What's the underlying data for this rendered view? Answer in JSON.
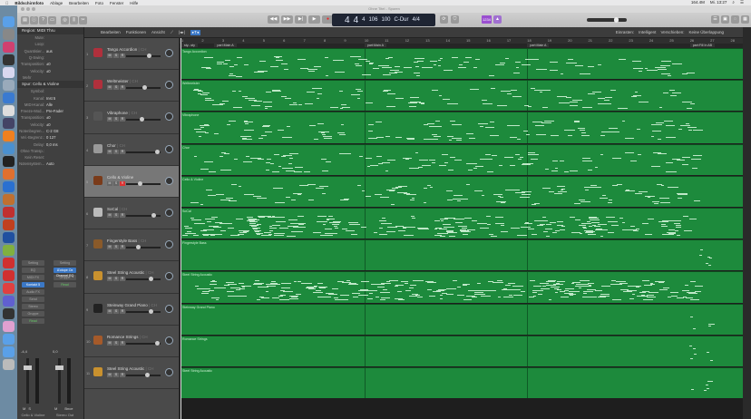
{
  "menubar": {
    "app": "Bildschirmfoto",
    "items": [
      "Ablage",
      "Bearbeiten",
      "Foto",
      "Fenster",
      "Hilfe"
    ],
    "memory": "164.4M",
    "clock": "Mi. 13:27"
  },
  "window": {
    "title": "Ohne Titel - Spuren"
  },
  "lcd": {
    "bar": "4",
    "beat": "4",
    "div": "4",
    "tempo": "106",
    "tick": "100",
    "key": "C-Dur",
    "signature": "4/4"
  },
  "count_in": "1234",
  "toolbar": {
    "edit": "Bearbeiten",
    "functions": "Funktionen",
    "view": "Ansicht",
    "snap_label": "Einrasten:",
    "snap_value": "Intelligent",
    "drag_label": "Verschieben:",
    "drag_value": "Keine Überlappung"
  },
  "inspector": {
    "region_header": "Region: MIDI Thru",
    "region_rows": [
      {
        "k": "Mute:",
        "v": ""
      },
      {
        "k": "Loop:",
        "v": ""
      },
      {
        "k": "Quantisier...",
        "v": "aus"
      },
      {
        "k": "Q-Swing:",
        "v": ""
      },
      {
        "k": "Transposition:",
        "v": "±0"
      },
      {
        "k": "Velocity:",
        "v": "±0"
      }
    ],
    "more": "Mehr",
    "track_header": "Spur: Cello & Violine",
    "track_rows": [
      {
        "k": "Symbol:",
        "v": ""
      },
      {
        "k": "Kanal:",
        "v": "Inst 5"
      },
      {
        "k": "MIDI-Kanal:",
        "v": "Alle"
      },
      {
        "k": "Freeze-Mod...",
        "v": "Pre-Fader"
      },
      {
        "k": "Transposition:",
        "v": "±0"
      },
      {
        "k": "Velocity:",
        "v": "±0"
      },
      {
        "k": "Notenbegren...",
        "v": "C-2  G8"
      },
      {
        "k": "Vel.-Begrenz.:",
        "v": "0  127"
      },
      {
        "k": "Delay:",
        "v": "0,0 ms"
      },
      {
        "k": "Ohne Transp.:",
        "v": ""
      },
      {
        "k": "Kein Reset:",
        "v": ""
      },
      {
        "k": "Notensystem...",
        "v": "Auto"
      }
    ],
    "strip1": {
      "buttons": [
        "Setting",
        "EQ",
        "MIDI FX",
        "Kontakt 5",
        "Audio FX",
        "Send",
        "Stereo",
        "Gruppe",
        "Read"
      ],
      "value": "-4,4",
      "mute": "M",
      "solo": "S",
      "name": "Cello & Violine"
    },
    "strip2": {
      "buttons": [
        "Setting",
        "iZotope Oz Channel EQ",
        "Gruppe",
        "Read"
      ],
      "value": "0,0",
      "mute": "M",
      "bounce": "Bnce",
      "name": "Stereo Out"
    }
  },
  "tracks": [
    {
      "num": "1",
      "name": "Tango Accordion",
      "color": "#b0303c"
    },
    {
      "num": "2",
      "name": "Weltmeister",
      "color": "#b0303c"
    },
    {
      "num": "3",
      "name": "Vibraphone",
      "color": "#555"
    },
    {
      "num": "4",
      "name": "Chor",
      "color": "#999"
    },
    {
      "num": "5",
      "name": "Cello & Violine",
      "color": "#7a3b1a",
      "selected": true
    },
    {
      "num": "6",
      "name": "SoCal",
      "color": "#bbb"
    },
    {
      "num": "7",
      "name": "Fingerstyle Bass",
      "color": "#8a5a2a"
    },
    {
      "num": "8",
      "name": "Steel String Acoustic",
      "color": "#c9912e"
    },
    {
      "num": "9",
      "name": "Steinway Grand Piano",
      "color": "#222"
    },
    {
      "num": "10",
      "name": "Romance Strings",
      "color": "#a55a2a"
    },
    {
      "num": "11",
      "name": "Steel String Acoustic",
      "color": "#c9912e"
    }
  ],
  "track_buttons": {
    "mute": "M",
    "solo": "S",
    "rec": "R",
    "channel_suffix": "CH"
  },
  "ruler": [
    "1",
    "2",
    "3",
    "4",
    "5",
    "6",
    "7",
    "8",
    "9",
    "10",
    "11",
    "12",
    "13",
    "14",
    "15",
    "16",
    "17",
    "18",
    "19",
    "20",
    "21",
    "22",
    "23",
    "24",
    "25",
    "26",
    "27",
    "28"
  ],
  "markers": [
    {
      "label": "sty...sty",
      "bar": 1
    },
    {
      "label": "part:Main A",
      "bar": 2
    },
    {
      "label": "part:Main A",
      "bar": 10
    },
    {
      "label": "part:Main A",
      "bar": 18
    },
    {
      "label": "part:Fill In AB",
      "bar": 26
    }
  ]
}
